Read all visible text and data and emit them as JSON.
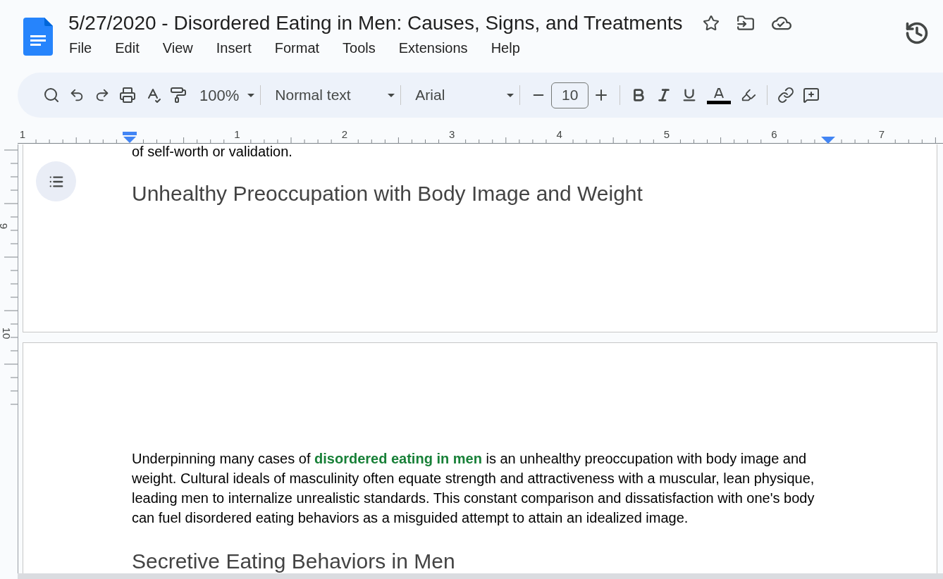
{
  "document": {
    "title": "5/27/2020 - Disordered Eating in Men: Causes, Signs, and Treatments",
    "starred": false
  },
  "menu": [
    "File",
    "Edit",
    "View",
    "Insert",
    "Format",
    "Tools",
    "Extensions",
    "Help"
  ],
  "toolbar": {
    "zoom": "100%",
    "style": "Normal text",
    "font": "Arial",
    "font_size": "10"
  },
  "ruler": {
    "numbers": [
      "1",
      "1",
      "2",
      "3",
      "4",
      "5",
      "6",
      "7"
    ]
  },
  "vertical_ruler": {
    "numbers": [
      "9",
      "10"
    ]
  },
  "page_1": {
    "cut_text": "of self-worth or validation.",
    "heading": "Unhealthy Preoccupation with Body Image and Weight"
  },
  "page_2": {
    "paragraph": {
      "before": "Underpinning many cases of ",
      "link": "disordered eating in men",
      "after": " is an unhealthy preoccupation with body image and weight. Cultural ideals of masculinity often equate strength and attractiveness with a muscular, lean physique, leading men to internalize unrealistic standards. This constant comparison and dissatisfaction with one's body can fuel disordered eating behaviors as a misguided attempt to attain an idealized image."
    },
    "heading": "Secretive Eating Behaviors in Men"
  }
}
